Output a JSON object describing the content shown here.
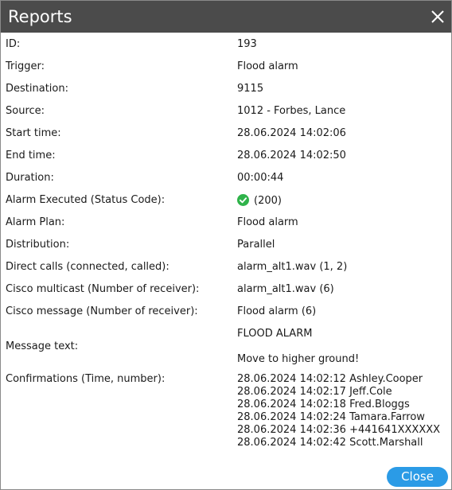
{
  "window": {
    "title": "Reports"
  },
  "fields": [
    {
      "label": "ID:",
      "value": "193"
    },
    {
      "label": "Trigger:",
      "value": "Flood alarm"
    },
    {
      "label": "Destination:",
      "value": "9115"
    },
    {
      "label": "Source:",
      "value": "1012 - Forbes, Lance"
    },
    {
      "label": "Start time:",
      "value": "28.06.2024 14:02:06"
    },
    {
      "label": "End time:",
      "value": "28.06.2024 14:02:50"
    },
    {
      "label": "Duration:",
      "value": "00:00:44"
    },
    {
      "label": "Alarm Executed (Status Code):",
      "value": "(200)",
      "icon": "check-circle-icon",
      "icon_color": "#2fb34a"
    },
    {
      "label": "Alarm Plan:",
      "value": "Flood alarm"
    },
    {
      "label": "Distribution:",
      "value": "Parallel"
    },
    {
      "label": "Direct calls (connected, called):",
      "value": "alarm_alt1.wav (1, 2)"
    },
    {
      "label": "Cisco multicast (Number of receiver):",
      "value": "alarm_alt1.wav (6)"
    },
    {
      "label": "Cisco message (Number of receiver):",
      "value": "Flood alarm (6)"
    }
  ],
  "message": {
    "label": "Message text:",
    "line1": "FLOOD ALARM",
    "line2": "Move to higher ground!"
  },
  "confirmations": {
    "label": "Confirmations (Time, number):",
    "items": [
      "28.06.2024 14:02:12 Ashley.Cooper",
      "28.06.2024 14:02:17 Jeff.Cole",
      "28.06.2024 14:02:18 Fred.Bloggs",
      "28.06.2024 14:02:24 Tamara.Farrow",
      "28.06.2024 14:02:36 +441641XXXXXX",
      "28.06.2024 14:02:42 Scott.Marshall"
    ]
  },
  "footer": {
    "close_label": "Close"
  },
  "colors": {
    "titlebar": "#4b4b4b",
    "accent": "#2b9be6",
    "success": "#2fb34a"
  }
}
